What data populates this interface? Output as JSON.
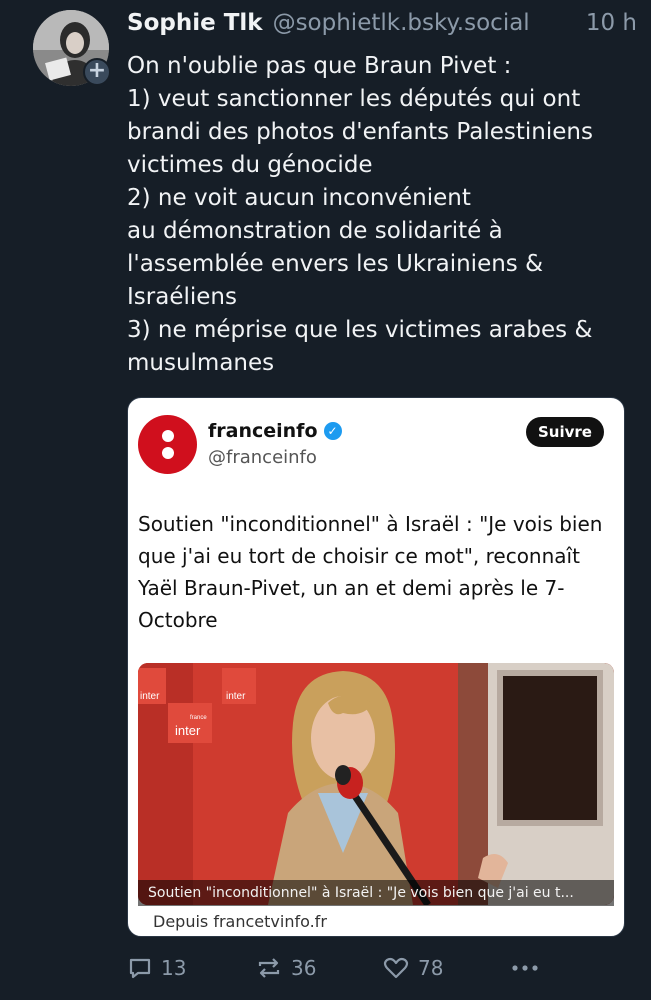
{
  "post": {
    "author_name": "Sophie Tlk",
    "author_handle": "@sophietlk.bsky.social",
    "time": "10 h",
    "text_lines": [
      "On n'oublie pas que Braun Pivet :",
      "1) veut sanctionner les députés qui ont",
      "brandi des photos d'enfants Palestiniens",
      "victimes du génocide",
      "2) ne voit aucun inconvénient",
      "au démonstration de solidarité à",
      "l'assemblée envers les Ukrainiens &",
      "Israéliens",
      "3) ne méprise que les victimes arabes &",
      "musulmanes"
    ],
    "avatar_icon": "profile-photo",
    "follow_icon": "plus-icon"
  },
  "embed": {
    "account_name": "franceinfo",
    "account_handle": "@franceinfo",
    "follow_label": "Suivre",
    "headline_lines": [
      "Soutien \"inconditionnel\" à Israël : \"Je vois bien",
      "que j'ai eu tort de choisir ce mot\", reconnaît",
      "Yaël Braun-Pivet, un an et demi après le 7-",
      "Octobre"
    ],
    "image_caption": "Soutien \"inconditionnel\" à Israël : \"Je vois bien que j'ai eu t...",
    "studio_signs": [
      "inter",
      "inter",
      "inter"
    ],
    "studio_small_text": "france",
    "source": "Depuis francetvinfo.fr",
    "brand_color": "#d00f1d"
  },
  "actions": {
    "reply_count": "13",
    "repost_count": "36",
    "like_count": "78"
  }
}
